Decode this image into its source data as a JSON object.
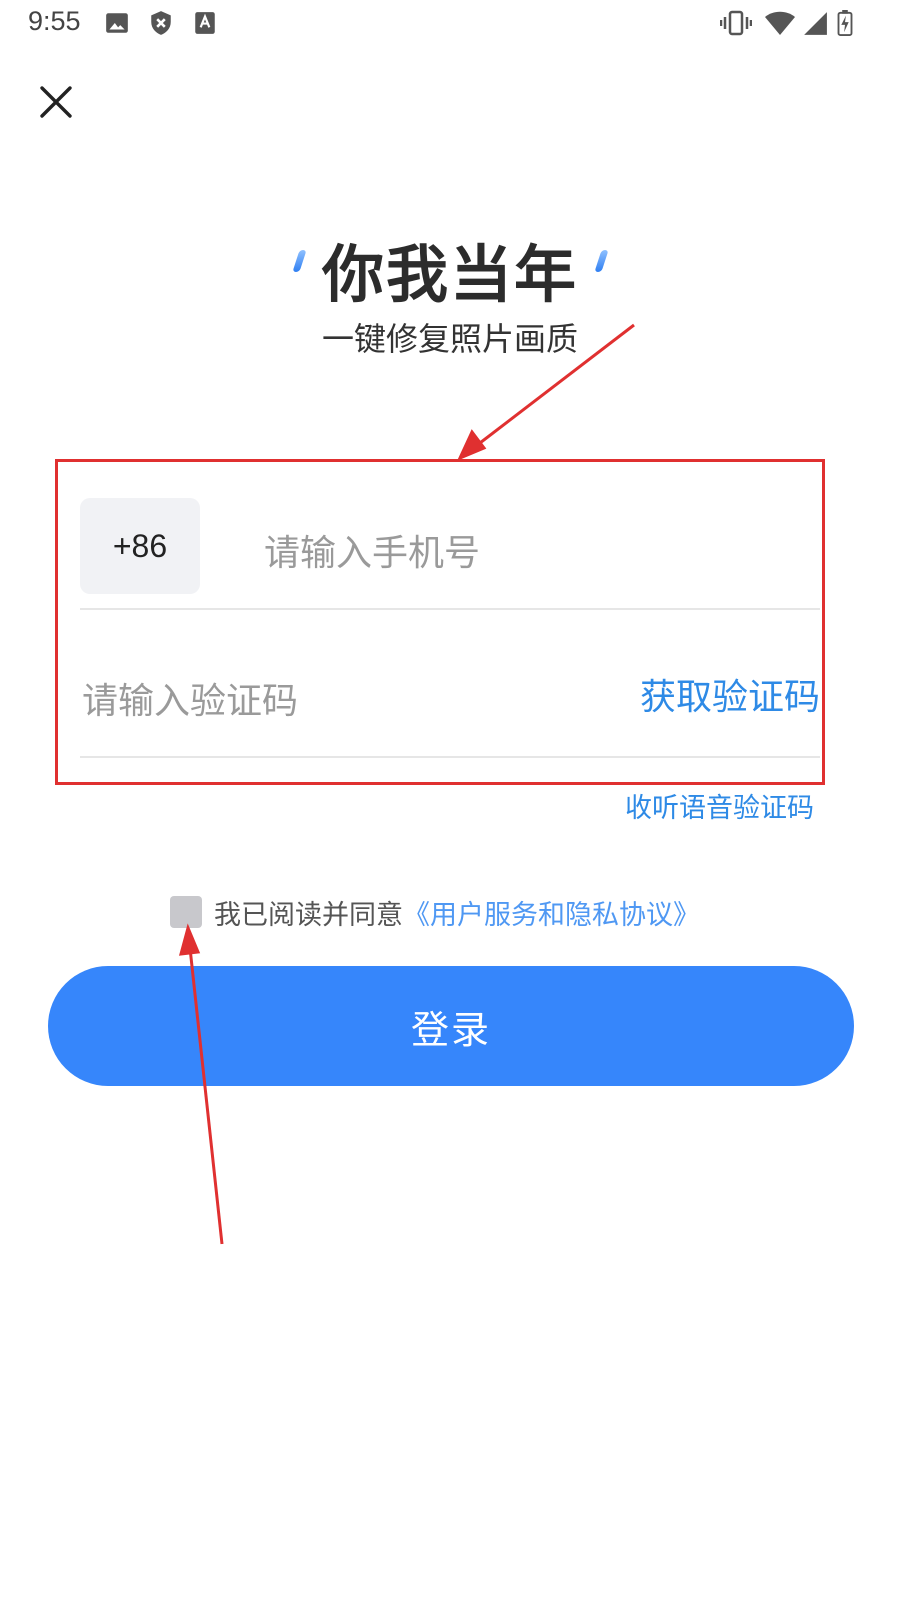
{
  "status_bar": {
    "time": "9:55",
    "left_icons": [
      "image-icon",
      "shield-x-icon",
      "accessibility-icon"
    ],
    "right_icons": [
      "vibrate-icon",
      "wifi-icon",
      "signal-icon",
      "battery-charging-icon"
    ]
  },
  "header": {
    "close_icon": "close-icon"
  },
  "brand": {
    "title": "你我当年",
    "subtitle": "一键修复照片画质"
  },
  "form": {
    "country_code": "+86",
    "phone_placeholder": "请输入手机号",
    "code_placeholder": "请输入验证码",
    "get_code_label": "获取验证码",
    "voice_code_label": "收听语音验证码"
  },
  "agreement": {
    "checked": false,
    "text": "我已阅读并同意",
    "link": "《用户服务和隐私协议》"
  },
  "login_button": "登录",
  "colors": {
    "primary": "#3686fb",
    "link": "#2e8ae6",
    "annotation": "#e03030",
    "country_code_bg": "#f1f2f5",
    "checkbox": "#c8c8cc"
  }
}
